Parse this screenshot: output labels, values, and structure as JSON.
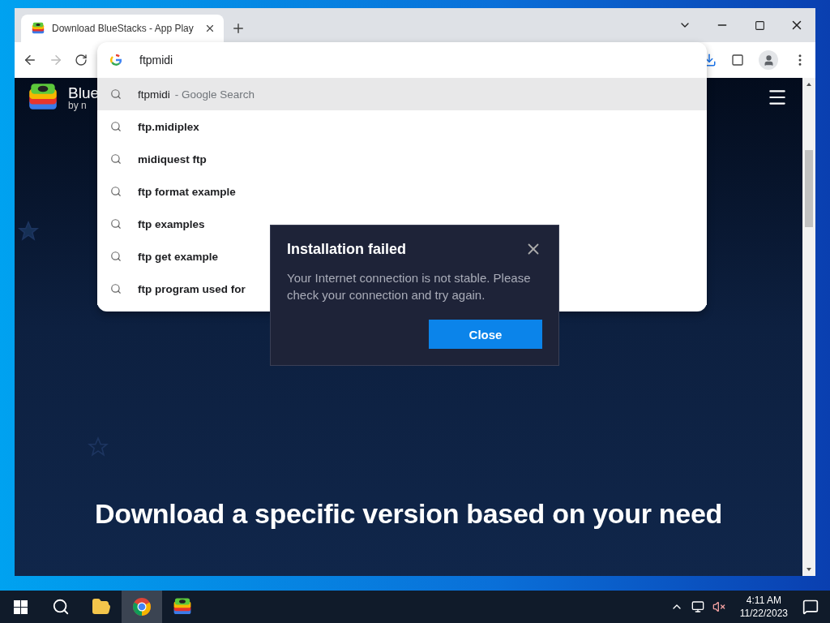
{
  "browser": {
    "tabs": [
      {
        "title": "Download BlueStacks - App Play",
        "selected": true
      }
    ],
    "omnibox": {
      "value": "ftpmidi",
      "suggestions": [
        {
          "text": "ftpmidi",
          "suffix": "- Google Search",
          "selected": true
        },
        {
          "text": "ftp.midiplex",
          "selected": false
        },
        {
          "text": "midiquest ftp",
          "selected": false
        },
        {
          "text": "ftp format example",
          "selected": false
        },
        {
          "text": "ftp examples",
          "selected": false
        },
        {
          "text": "ftp get example",
          "selected": false
        },
        {
          "text": "ftp program used for",
          "selected": false
        }
      ]
    }
  },
  "page": {
    "logo": {
      "line1": "Blue",
      "line2": "by n"
    },
    "headline": "Download a specific version based on your need",
    "dialog": {
      "title": "Installation failed",
      "message": "Your Internet connection is not stable. Please check your connection and try again.",
      "button": "Close"
    }
  },
  "taskbar": {
    "apps": [
      {
        "kind": "explorer",
        "active": false
      },
      {
        "kind": "chrome",
        "active": true
      },
      {
        "kind": "bluestacks",
        "active": false
      }
    ],
    "time": "4:11 AM",
    "date": "11/22/2023"
  }
}
